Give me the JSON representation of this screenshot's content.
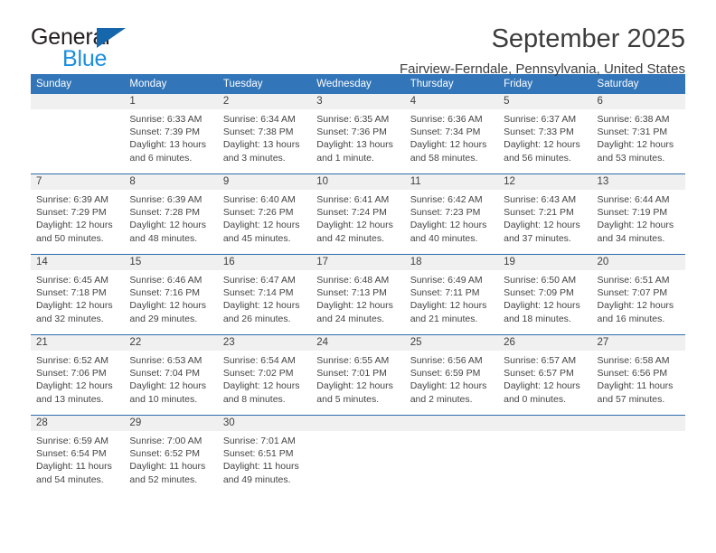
{
  "brand": {
    "name_top": "General",
    "name_bottom": "Blue",
    "triangle_color": "#1566ab",
    "blue_text_color": "#1b8ede"
  },
  "header": {
    "title": "September 2025",
    "subtitle": "Fairview-Ferndale, Pennsylvania, United States"
  },
  "colors": {
    "header_blue": "#3275b9",
    "week_rule": "#2b6cad",
    "daynum_band": "#f0f0f0"
  },
  "weekday_headers": [
    "Sunday",
    "Monday",
    "Tuesday",
    "Wednesday",
    "Thursday",
    "Friday",
    "Saturday"
  ],
  "weeks": [
    {
      "days": [
        {
          "num": "",
          "sunrise": "",
          "sunset": "",
          "daylight1": "",
          "daylight2": "",
          "empty": true
        },
        {
          "num": "1",
          "sunrise": "Sunrise: 6:33 AM",
          "sunset": "Sunset: 7:39 PM",
          "daylight1": "Daylight: 13 hours",
          "daylight2": "and 6 minutes.",
          "empty": false
        },
        {
          "num": "2",
          "sunrise": "Sunrise: 6:34 AM",
          "sunset": "Sunset: 7:38 PM",
          "daylight1": "Daylight: 13 hours",
          "daylight2": "and 3 minutes.",
          "empty": false
        },
        {
          "num": "3",
          "sunrise": "Sunrise: 6:35 AM",
          "sunset": "Sunset: 7:36 PM",
          "daylight1": "Daylight: 13 hours",
          "daylight2": "and 1 minute.",
          "empty": false
        },
        {
          "num": "4",
          "sunrise": "Sunrise: 6:36 AM",
          "sunset": "Sunset: 7:34 PM",
          "daylight1": "Daylight: 12 hours",
          "daylight2": "and 58 minutes.",
          "empty": false
        },
        {
          "num": "5",
          "sunrise": "Sunrise: 6:37 AM",
          "sunset": "Sunset: 7:33 PM",
          "daylight1": "Daylight: 12 hours",
          "daylight2": "and 56 minutes.",
          "empty": false
        },
        {
          "num": "6",
          "sunrise": "Sunrise: 6:38 AM",
          "sunset": "Sunset: 7:31 PM",
          "daylight1": "Daylight: 12 hours",
          "daylight2": "and 53 minutes.",
          "empty": false
        }
      ]
    },
    {
      "days": [
        {
          "num": "7",
          "sunrise": "Sunrise: 6:39 AM",
          "sunset": "Sunset: 7:29 PM",
          "daylight1": "Daylight: 12 hours",
          "daylight2": "and 50 minutes.",
          "empty": false
        },
        {
          "num": "8",
          "sunrise": "Sunrise: 6:39 AM",
          "sunset": "Sunset: 7:28 PM",
          "daylight1": "Daylight: 12 hours",
          "daylight2": "and 48 minutes.",
          "empty": false
        },
        {
          "num": "9",
          "sunrise": "Sunrise: 6:40 AM",
          "sunset": "Sunset: 7:26 PM",
          "daylight1": "Daylight: 12 hours",
          "daylight2": "and 45 minutes.",
          "empty": false
        },
        {
          "num": "10",
          "sunrise": "Sunrise: 6:41 AM",
          "sunset": "Sunset: 7:24 PM",
          "daylight1": "Daylight: 12 hours",
          "daylight2": "and 42 minutes.",
          "empty": false
        },
        {
          "num": "11",
          "sunrise": "Sunrise: 6:42 AM",
          "sunset": "Sunset: 7:23 PM",
          "daylight1": "Daylight: 12 hours",
          "daylight2": "and 40 minutes.",
          "empty": false
        },
        {
          "num": "12",
          "sunrise": "Sunrise: 6:43 AM",
          "sunset": "Sunset: 7:21 PM",
          "daylight1": "Daylight: 12 hours",
          "daylight2": "and 37 minutes.",
          "empty": false
        },
        {
          "num": "13",
          "sunrise": "Sunrise: 6:44 AM",
          "sunset": "Sunset: 7:19 PM",
          "daylight1": "Daylight: 12 hours",
          "daylight2": "and 34 minutes.",
          "empty": false
        }
      ]
    },
    {
      "days": [
        {
          "num": "14",
          "sunrise": "Sunrise: 6:45 AM",
          "sunset": "Sunset: 7:18 PM",
          "daylight1": "Daylight: 12 hours",
          "daylight2": "and 32 minutes.",
          "empty": false
        },
        {
          "num": "15",
          "sunrise": "Sunrise: 6:46 AM",
          "sunset": "Sunset: 7:16 PM",
          "daylight1": "Daylight: 12 hours",
          "daylight2": "and 29 minutes.",
          "empty": false
        },
        {
          "num": "16",
          "sunrise": "Sunrise: 6:47 AM",
          "sunset": "Sunset: 7:14 PM",
          "daylight1": "Daylight: 12 hours",
          "daylight2": "and 26 minutes.",
          "empty": false
        },
        {
          "num": "17",
          "sunrise": "Sunrise: 6:48 AM",
          "sunset": "Sunset: 7:13 PM",
          "daylight1": "Daylight: 12 hours",
          "daylight2": "and 24 minutes.",
          "empty": false
        },
        {
          "num": "18",
          "sunrise": "Sunrise: 6:49 AM",
          "sunset": "Sunset: 7:11 PM",
          "daylight1": "Daylight: 12 hours",
          "daylight2": "and 21 minutes.",
          "empty": false
        },
        {
          "num": "19",
          "sunrise": "Sunrise: 6:50 AM",
          "sunset": "Sunset: 7:09 PM",
          "daylight1": "Daylight: 12 hours",
          "daylight2": "and 18 minutes.",
          "empty": false
        },
        {
          "num": "20",
          "sunrise": "Sunrise: 6:51 AM",
          "sunset": "Sunset: 7:07 PM",
          "daylight1": "Daylight: 12 hours",
          "daylight2": "and 16 minutes.",
          "empty": false
        }
      ]
    },
    {
      "days": [
        {
          "num": "21",
          "sunrise": "Sunrise: 6:52 AM",
          "sunset": "Sunset: 7:06 PM",
          "daylight1": "Daylight: 12 hours",
          "daylight2": "and 13 minutes.",
          "empty": false
        },
        {
          "num": "22",
          "sunrise": "Sunrise: 6:53 AM",
          "sunset": "Sunset: 7:04 PM",
          "daylight1": "Daylight: 12 hours",
          "daylight2": "and 10 minutes.",
          "empty": false
        },
        {
          "num": "23",
          "sunrise": "Sunrise: 6:54 AM",
          "sunset": "Sunset: 7:02 PM",
          "daylight1": "Daylight: 12 hours",
          "daylight2": "and 8 minutes.",
          "empty": false
        },
        {
          "num": "24",
          "sunrise": "Sunrise: 6:55 AM",
          "sunset": "Sunset: 7:01 PM",
          "daylight1": "Daylight: 12 hours",
          "daylight2": "and 5 minutes.",
          "empty": false
        },
        {
          "num": "25",
          "sunrise": "Sunrise: 6:56 AM",
          "sunset": "Sunset: 6:59 PM",
          "daylight1": "Daylight: 12 hours",
          "daylight2": "and 2 minutes.",
          "empty": false
        },
        {
          "num": "26",
          "sunrise": "Sunrise: 6:57 AM",
          "sunset": "Sunset: 6:57 PM",
          "daylight1": "Daylight: 12 hours",
          "daylight2": "and 0 minutes.",
          "empty": false
        },
        {
          "num": "27",
          "sunrise": "Sunrise: 6:58 AM",
          "sunset": "Sunset: 6:56 PM",
          "daylight1": "Daylight: 11 hours",
          "daylight2": "and 57 minutes.",
          "empty": false
        }
      ]
    },
    {
      "days": [
        {
          "num": "28",
          "sunrise": "Sunrise: 6:59 AM",
          "sunset": "Sunset: 6:54 PM",
          "daylight1": "Daylight: 11 hours",
          "daylight2": "and 54 minutes.",
          "empty": false
        },
        {
          "num": "29",
          "sunrise": "Sunrise: 7:00 AM",
          "sunset": "Sunset: 6:52 PM",
          "daylight1": "Daylight: 11 hours",
          "daylight2": "and 52 minutes.",
          "empty": false
        },
        {
          "num": "30",
          "sunrise": "Sunrise: 7:01 AM",
          "sunset": "Sunset: 6:51 PM",
          "daylight1": "Daylight: 11 hours",
          "daylight2": "and 49 minutes.",
          "empty": false
        },
        {
          "num": "",
          "sunrise": "",
          "sunset": "",
          "daylight1": "",
          "daylight2": "",
          "empty": true
        },
        {
          "num": "",
          "sunrise": "",
          "sunset": "",
          "daylight1": "",
          "daylight2": "",
          "empty": true
        },
        {
          "num": "",
          "sunrise": "",
          "sunset": "",
          "daylight1": "",
          "daylight2": "",
          "empty": true
        },
        {
          "num": "",
          "sunrise": "",
          "sunset": "",
          "daylight1": "",
          "daylight2": "",
          "empty": true
        }
      ]
    }
  ]
}
